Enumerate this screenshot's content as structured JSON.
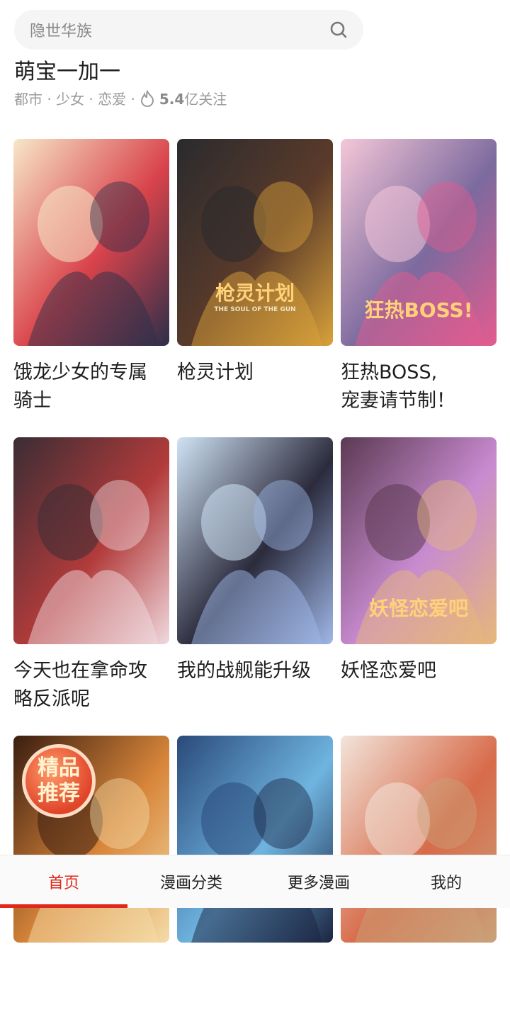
{
  "search": {
    "placeholder": "隐世华族"
  },
  "featured": {
    "title": "萌宝一加一",
    "tags": "都市 · 少女 · 恋爱 ·",
    "follow_count": "5.4",
    "follow_unit": "亿关注"
  },
  "comics": [
    {
      "title": "饿龙少女的专属\n骑士",
      "palette": [
        "#f7e7c8",
        "#d9434b",
        "#2c2f4a"
      ]
    },
    {
      "title": "枪灵计划",
      "palette": [
        "#2a2a2e",
        "#5b3b2a",
        "#d9a23a"
      ],
      "cover_text": "枪灵计划",
      "cover_sub": "THE SOUL OF THE GUN"
    },
    {
      "title": "狂热BOSS,\n宠妻请节制！",
      "palette": [
        "#f4c7d8",
        "#7c6a9e",
        "#e45b8f"
      ],
      "cover_text": "狂热BOSS!"
    },
    {
      "title": "今天也在拿命攻\n略反派呢",
      "palette": [
        "#3a2d34",
        "#b23b3b",
        "#f0d9de"
      ]
    },
    {
      "title": "我的战舰能升级",
      "palette": [
        "#cfe3f5",
        "#2b2b3c",
        "#9fb7e8"
      ]
    },
    {
      "title": "妖怪恋爱吧",
      "palette": [
        "#5b3a52",
        "#c88bd0",
        "#e7b77a"
      ],
      "cover_text": "妖怪恋爱吧"
    },
    {
      "title": "",
      "palette": [
        "#3a1d10",
        "#d8863a",
        "#f4dca8"
      ],
      "badge": [
        "精品",
        "推荐"
      ]
    },
    {
      "title": "",
      "palette": [
        "#2a4a7a",
        "#6fb4e0",
        "#1b2440"
      ]
    },
    {
      "title": "",
      "palette": [
        "#f2e4da",
        "#d76b4a",
        "#c9a27a"
      ]
    }
  ],
  "tabs": [
    {
      "label": "首页",
      "active": true
    },
    {
      "label": "漫画分类",
      "active": false
    },
    {
      "label": "更多漫画",
      "active": false
    },
    {
      "label": "我的",
      "active": false
    }
  ]
}
